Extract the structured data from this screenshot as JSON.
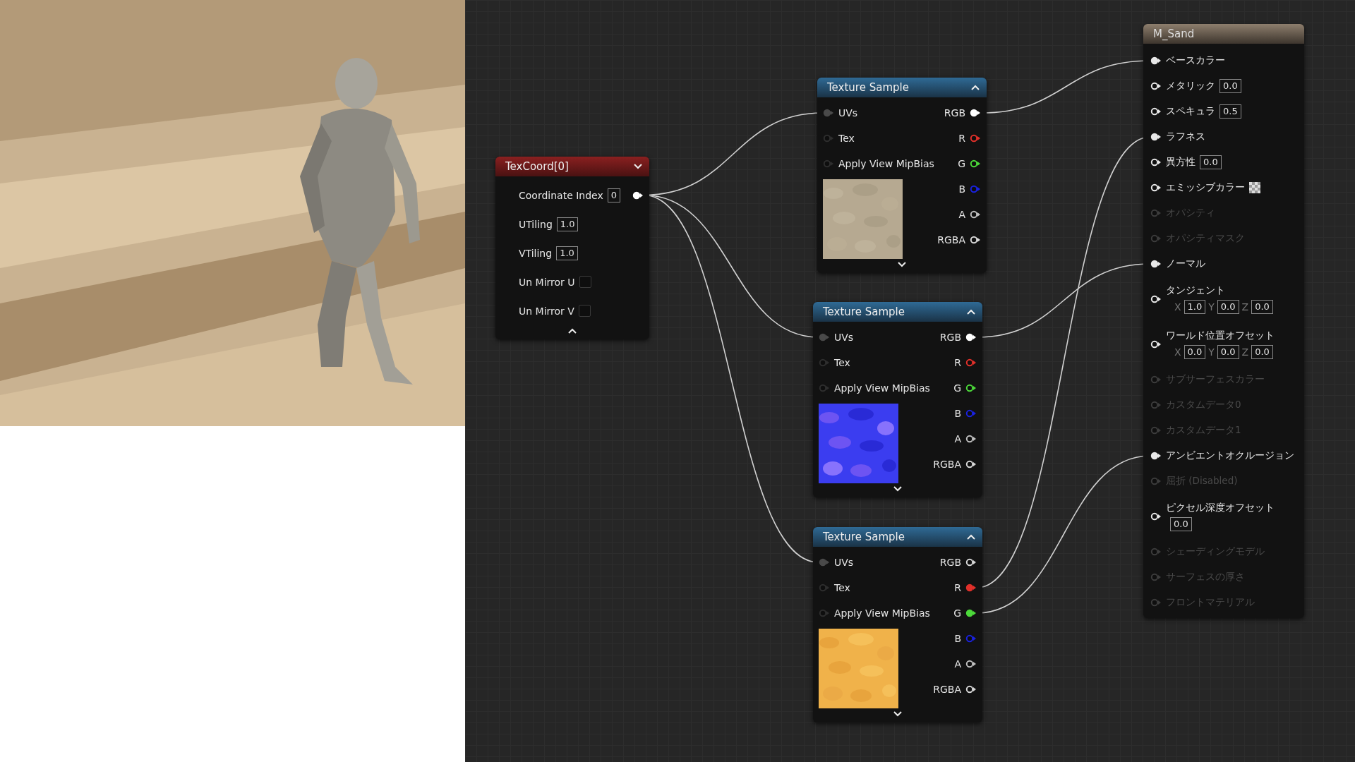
{
  "nodes": [
    {
      "kind": "texcoord",
      "title": "TexCoord[0]",
      "properties": [
        {
          "kind": "field",
          "label": "Coordinate Index",
          "value": "0"
        },
        {
          "kind": "field",
          "label": "UTiling",
          "value": "1.0"
        },
        {
          "kind": "field",
          "label": "VTiling",
          "value": "1.0"
        },
        {
          "kind": "checkbox",
          "label": "Un Mirror U",
          "checked": false
        },
        {
          "kind": "checkbox",
          "label": "Un Mirror V",
          "checked": false
        }
      ],
      "outputs": [
        {
          "connected": true,
          "color": "#ffffff"
        }
      ]
    },
    {
      "kind": "texture_sample",
      "title": "Texture Sample",
      "inputs": [
        {
          "label": "UVs",
          "connected": true
        },
        {
          "label": "Tex",
          "connected": false
        },
        {
          "label": "Apply View MipBias",
          "connected": false
        }
      ],
      "outputs": [
        {
          "label": "RGB",
          "color": "#ffffff",
          "connected": true
        },
        {
          "label": "R",
          "color": "#e0302a",
          "connected": false
        },
        {
          "label": "G",
          "color": "#4cd93a",
          "connected": false
        },
        {
          "label": "B",
          "color": "#1a22e0",
          "connected": false
        },
        {
          "label": "A",
          "color": "#bfbfbf",
          "connected": false
        },
        {
          "label": "RGBA",
          "color": "#d8d8d8",
          "connected": false
        }
      ]
    },
    {
      "kind": "texture_sample",
      "title": "Texture Sample",
      "inputs": [
        {
          "label": "UVs",
          "connected": true
        },
        {
          "label": "Tex",
          "connected": false
        },
        {
          "label": "Apply View MipBias",
          "connected": false
        }
      ],
      "outputs": [
        {
          "label": "RGB",
          "color": "#ffffff",
          "connected": true
        },
        {
          "label": "R",
          "color": "#e0302a",
          "connected": false
        },
        {
          "label": "G",
          "color": "#4cd93a",
          "connected": false
        },
        {
          "label": "B",
          "color": "#1a22e0",
          "connected": false
        },
        {
          "label": "A",
          "color": "#bfbfbf",
          "connected": false
        },
        {
          "label": "RGBA",
          "color": "#d8d8d8",
          "connected": false
        }
      ]
    },
    {
      "kind": "texture_sample",
      "title": "Texture Sample",
      "inputs": [
        {
          "label": "UVs",
          "connected": true
        },
        {
          "label": "Tex",
          "connected": false
        },
        {
          "label": "Apply View MipBias",
          "connected": false
        }
      ],
      "outputs": [
        {
          "label": "RGB",
          "color": "#d8d8d8",
          "connected": false
        },
        {
          "label": "R",
          "color": "#e0302a",
          "connected": true
        },
        {
          "label": "G",
          "color": "#4cd93a",
          "connected": true
        },
        {
          "label": "B",
          "color": "#1a22e0",
          "connected": false
        },
        {
          "label": "A",
          "color": "#bfbfbf",
          "connected": false
        },
        {
          "label": "RGBA",
          "color": "#d8d8d8",
          "connected": false
        }
      ]
    },
    {
      "kind": "material",
      "title": "M_Sand",
      "inputs": [
        {
          "label": "ベースカラー",
          "connected": true,
          "disabled": false
        },
        {
          "label": "メタリック",
          "connected": false,
          "disabled": false,
          "value": "0.0"
        },
        {
          "label": "スペキュラ",
          "connected": false,
          "disabled": false,
          "value": "0.5"
        },
        {
          "label": "ラフネス",
          "connected": true,
          "disabled": false
        },
        {
          "label": "異方性",
          "connected": false,
          "disabled": false,
          "value": "0.0"
        },
        {
          "label": "エミッシブカラー",
          "connected": false,
          "disabled": false,
          "swatch": true
        },
        {
          "label": "オパシティ",
          "connected": false,
          "disabled": true
        },
        {
          "label": "オパシティマスク",
          "connected": false,
          "disabled": true
        },
        {
          "label": "ノーマル",
          "connected": true,
          "disabled": false
        },
        {
          "label": "タンジェント",
          "connected": false,
          "disabled": false,
          "vector": [
            {
              "axis": "X",
              "value": "1.0"
            },
            {
              "axis": "Y",
              "value": "0.0"
            },
            {
              "axis": "Z",
              "value": "0.0"
            }
          ]
        },
        {
          "label": "ワールド位置オフセット",
          "connected": false,
          "disabled": false,
          "vector": [
            {
              "axis": "X",
              "value": "0.0"
            },
            {
              "axis": "Y",
              "value": "0.0"
            },
            {
              "axis": "Z",
              "value": "0.0"
            }
          ]
        },
        {
          "label": "サブサーフェスカラー",
          "connected": false,
          "disabled": true
        },
        {
          "label": "カスタムデータ0",
          "connected": false,
          "disabled": true
        },
        {
          "label": "カスタムデータ1",
          "connected": false,
          "disabled": true
        },
        {
          "label": "アンビエントオクルージョン",
          "connected": true,
          "disabled": false
        },
        {
          "label": "屈折 (Disabled)",
          "connected": false,
          "disabled": true
        },
        {
          "label": "ピクセル深度オフセット",
          "connected": false,
          "disabled": false,
          "value": "0.0",
          "value_below": true
        },
        {
          "label": "シェーディングモデル",
          "connected": false,
          "disabled": true
        },
        {
          "label": "サーフェスの厚さ",
          "connected": false,
          "disabled": true
        },
        {
          "label": "フロントマテリアル",
          "connected": false,
          "disabled": true
        }
      ]
    }
  ]
}
